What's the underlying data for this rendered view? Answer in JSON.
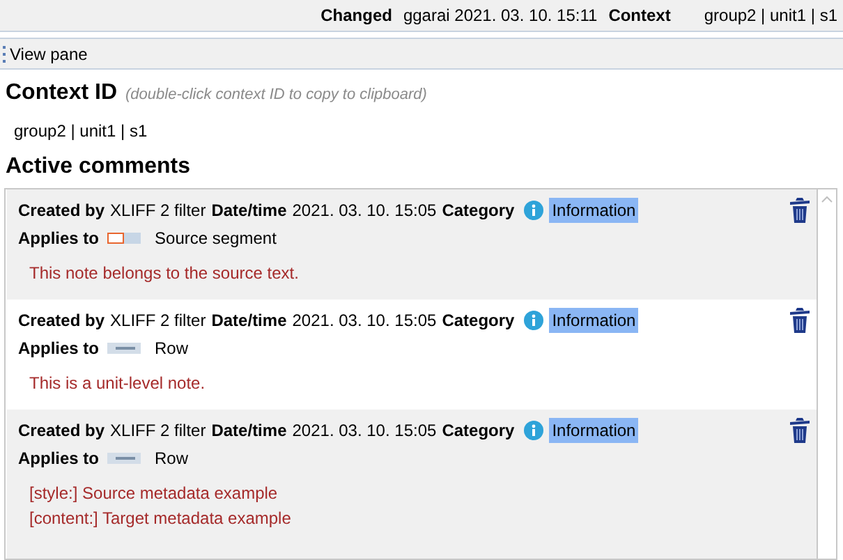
{
  "header": {
    "changed_label": "Changed",
    "changed_value": "ggarai 2021. 03. 10. 15:11",
    "context_label": "Context",
    "context_value": "group2 | unit1 | s1"
  },
  "toolbar": {
    "label": "View pane"
  },
  "context_id": {
    "title": "Context ID",
    "hint": "(double-click context ID to copy to clipboard)",
    "value": "group2 | unit1 | s1"
  },
  "comments_title": "Active comments",
  "comments": [
    {
      "created_by_label": "Created by",
      "created_by": "XLIFF 2 filter",
      "date_label": "Date/time",
      "date": "2021. 03. 10. 15:05",
      "category_label": "Category",
      "category": "Information",
      "applies_label": "Applies to",
      "applies": {
        "kind": "source",
        "label": "Source segment"
      },
      "notes": [
        "This note belongs to the source text."
      ]
    },
    {
      "created_by_label": "Created by",
      "created_by": "XLIFF 2 filter",
      "date_label": "Date/time",
      "date": "2021. 03. 10. 15:05",
      "category_label": "Category",
      "category": "Information",
      "applies_label": "Applies to",
      "applies": {
        "kind": "row",
        "label": "Row"
      },
      "notes": [
        "This is a unit-level note."
      ]
    },
    {
      "created_by_label": "Created by",
      "created_by": "XLIFF 2 filter",
      "date_label": "Date/time",
      "date": "2021. 03. 10. 15:05",
      "category_label": "Category",
      "category": "Information",
      "applies_label": "Applies to",
      "applies": {
        "kind": "row",
        "label": "Row"
      },
      "notes": [
        "[style:] Source metadata example",
        "[content:] Target metadata example"
      ]
    }
  ]
}
